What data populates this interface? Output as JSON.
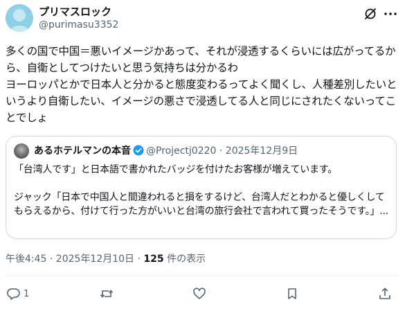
{
  "author": {
    "display_name": "プリマスロック",
    "handle": "@purimasu3352"
  },
  "post": {
    "text": "多くの国で中国＝悪いイメージかあって、それが浸透するくらいには広がってるから、自衛としてつけたいと思う気持ちは分かるわ\nヨーロッパとかで日本人と分かると態度変わるってよく聞くし、人種差別したいというより自衛したい、イメージの悪さで浸透してる人と同じにされたくないってことでしょ"
  },
  "quote": {
    "display_name": "あるホテルマンの本音",
    "handle": "@Projectj0220",
    "separator": "·",
    "date": "2025年12月9日",
    "text": "「台湾人です」と日本語で書かれたバッジを付けたお客様が増えています。\n\nジャック「日本で中国人と間違われると損をするけど、台湾人だとわかると優しくしてもらえるから、付けて行った方がいいと台湾の旅行会社で言われて買ったそうです。」..."
  },
  "meta": {
    "time_date": "午後4:45 · 2025年12月10日 · ",
    "views_count": "125",
    "views_label": " 件の表示"
  },
  "actions": {
    "reply_count": "1"
  },
  "icons": [
    "grok-icon",
    "more-icon",
    "verified-badge-icon",
    "reply-icon",
    "repost-icon",
    "like-icon",
    "bookmark-icon",
    "share-icon"
  ],
  "colors": {
    "text": "#0f1419",
    "secondary": "#536471",
    "border": "#cfd9de",
    "verified": "#1d9bf0",
    "avatar": "#8ed0e6"
  }
}
